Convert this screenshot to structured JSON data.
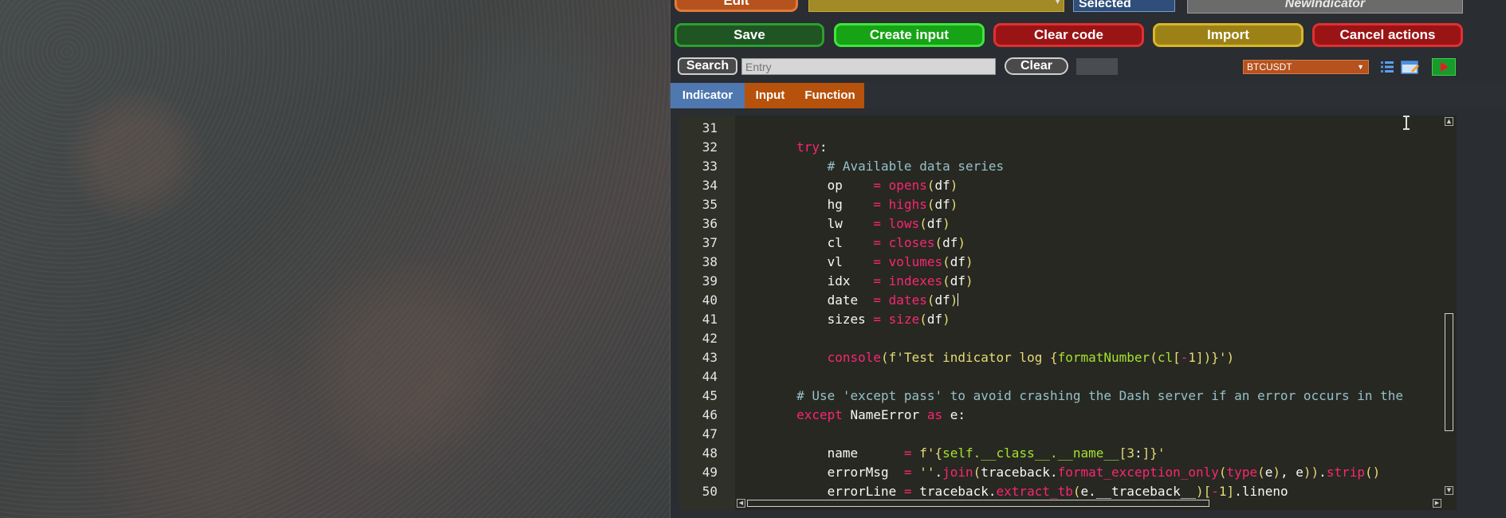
{
  "top_partial": {
    "edit_label": "Edit",
    "selected_label": "Selected",
    "name_value": "NewIndicator"
  },
  "actions": {
    "save": "Save",
    "create_input": "Create input",
    "clear_code": "Clear code",
    "import": "Import",
    "cancel_actions": "Cancel actions"
  },
  "search": {
    "button_label": "Search",
    "placeholder": "Entry",
    "clear_label": "Clear"
  },
  "symbol_select": {
    "value": "BTCUSDT"
  },
  "tabs": [
    {
      "label": "Indicator",
      "active": true
    },
    {
      "label": "Input",
      "active": false
    },
    {
      "label": "Function",
      "active": false
    }
  ],
  "editor": {
    "line_numbers": [
      "31",
      "32",
      "33",
      "34",
      "35",
      "36",
      "37",
      "38",
      "39",
      "40",
      "41",
      "42",
      "43",
      "44",
      "45",
      "46",
      "47",
      "48",
      "49",
      "50"
    ]
  },
  "colors": {
    "active_tab": "#4f78b0",
    "inactive_tab": "#b6520c",
    "editor_bg": "#272822",
    "keyword": "#f92672",
    "comment": "#95c0c8",
    "string": "#e6db74"
  },
  "icons": [
    "list-icon",
    "edit-note-icon",
    "play-icon",
    "scroll-up-icon",
    "scroll-down-icon",
    "scroll-left-icon",
    "scroll-right-icon",
    "chevron-down-icon"
  ]
}
